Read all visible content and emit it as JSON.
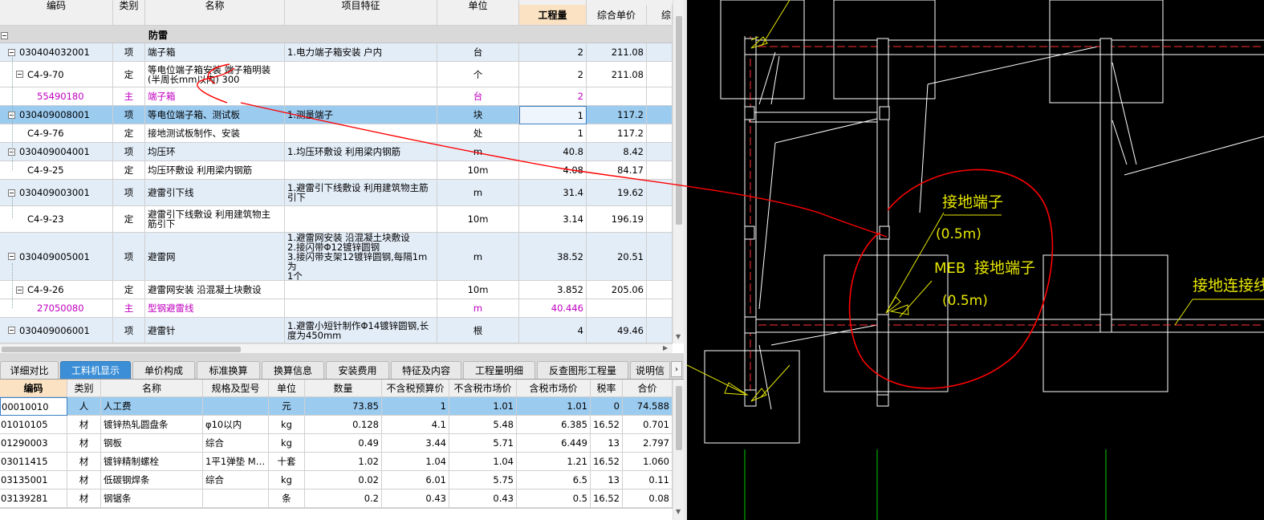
{
  "top_table": {
    "headers": {
      "code": "编码",
      "type": "类别",
      "name": "名称",
      "feature": "项目特征",
      "unit": "单位",
      "qty": "工程量",
      "price": "综合单价",
      "total": "综"
    },
    "group_title": "防雷",
    "rows": [
      {
        "code": "030404032001",
        "type": "项",
        "name": "端子箱",
        "feature": "1.电力端子箱安装 户内",
        "unit": "台",
        "qty": "2",
        "price": "211.08"
      },
      {
        "code": "C4-9-70",
        "type": "定",
        "name": "等电位端子箱安装 端子箱明装\n(半周长mm以内) 300",
        "feature": "",
        "unit": "个",
        "qty": "2",
        "price": "211.08"
      },
      {
        "code": "55490180",
        "type": "主",
        "name": "端子箱",
        "feature": "",
        "unit": "台",
        "qty": "2",
        "price": ""
      },
      {
        "code": "030409008001",
        "type": "项",
        "name": "等电位端子箱、测试板",
        "feature": "1.测量端子",
        "unit": "块",
        "qty": "1",
        "price": "117.2"
      },
      {
        "code": "C4-9-76",
        "type": "定",
        "name": "接地测试板制作、安装",
        "feature": "",
        "unit": "处",
        "qty": "1",
        "price": "117.2"
      },
      {
        "code": "030409004001",
        "type": "项",
        "name": "均压环",
        "feature": "1.均压环敷设 利用梁内钢筋",
        "unit": "m",
        "qty": "40.8",
        "price": "8.42"
      },
      {
        "code": "C4-9-25",
        "type": "定",
        "name": "均压环敷设 利用梁内钢筋",
        "feature": "",
        "unit": "10m",
        "qty": "4.08",
        "price": "84.17"
      },
      {
        "code": "030409003001",
        "type": "项",
        "name": "避雷引下线",
        "feature": "1.避雷引下线敷设 利用建筑物主筋\n引下",
        "unit": "m",
        "qty": "31.4",
        "price": "19.62"
      },
      {
        "code": "C4-9-23",
        "type": "定",
        "name": "避雷引下线敷设 利用建筑物主\n筋引下",
        "feature": "",
        "unit": "10m",
        "qty": "3.14",
        "price": "196.19"
      },
      {
        "code": "030409005001",
        "type": "项",
        "name": "避雷网",
        "feature": "1.避雷网安装 沿混凝土块敷设\n2.接闪带Φ12镀锌圆钢\n3.接闪带支架12镀锌圆钢,每隔1m为\n1个",
        "unit": "m",
        "qty": "38.52",
        "price": "20.51"
      },
      {
        "code": "C4-9-26",
        "type": "定",
        "name": "避雷网安装 沿混凝土块敷设",
        "feature": "",
        "unit": "10m",
        "qty": "3.852",
        "price": "205.06"
      },
      {
        "code": "27050080",
        "type": "主",
        "name": "型钢避雷线",
        "feature": "",
        "unit": "m",
        "qty": "40.446",
        "price": ""
      },
      {
        "code": "030409006001",
        "type": "项",
        "name": "避雷针",
        "feature": "1.避雷小短针制作Φ14镀锌圆钢,长\n度为450mm",
        "unit": "根",
        "qty": "4",
        "price": "49.46"
      }
    ]
  },
  "tabs": [
    "详细对比",
    "工料机显示",
    "单价构成",
    "标准换算",
    "换算信息",
    "安装费用",
    "特征及内容",
    "工程量明细",
    "反查图形工程量",
    "说明信"
  ],
  "active_tab": "工料机显示",
  "bottom_table": {
    "headers": {
      "code": "编码",
      "type": "类别",
      "name": "名称",
      "spec": "规格及型号",
      "unit": "单位",
      "qty": "数量",
      "budget": "不含税预算价",
      "market": "不含税市场价",
      "taxmarket": "含税市场价",
      "rate": "税率",
      "total": "合价"
    },
    "rows": [
      {
        "code": "00010010",
        "type": "人",
        "name": "人工费",
        "spec": "",
        "unit": "元",
        "qty": "73.85",
        "budget": "1",
        "market": "1.01",
        "taxmarket": "1.01",
        "rate": "0",
        "total": "74.588"
      },
      {
        "code": "01010105",
        "type": "材",
        "name": "镀锌热轧圆盘条",
        "spec": "φ10以内",
        "unit": "kg",
        "qty": "0.128",
        "budget": "4.1",
        "market": "5.48",
        "taxmarket": "6.385",
        "rate": "16.52",
        "total": "0.701"
      },
      {
        "code": "01290003",
        "type": "材",
        "name": "钢板",
        "spec": "综合",
        "unit": "kg",
        "qty": "0.49",
        "budget": "3.44",
        "market": "5.71",
        "taxmarket": "6.449",
        "rate": "13",
        "total": "2.797"
      },
      {
        "code": "03011415",
        "type": "材",
        "name": "镀锌精制螺栓",
        "spec": "1平1弹垫 M…",
        "unit": "十套",
        "qty": "1.02",
        "budget": "1.04",
        "market": "1.04",
        "taxmarket": "1.21",
        "rate": "16.52",
        "total": "1.060"
      },
      {
        "code": "03135001",
        "type": "材",
        "name": "低碳钢焊条",
        "spec": "综合",
        "unit": "kg",
        "qty": "0.02",
        "budget": "6.01",
        "market": "5.75",
        "taxmarket": "6.5",
        "rate": "13",
        "total": "0.11"
      },
      {
        "code": "03139281",
        "type": "材",
        "name": "钢锯条",
        "spec": "",
        "unit": "条",
        "qty": "0.2",
        "budget": "0.43",
        "market": "0.43",
        "taxmarket": "0.5",
        "rate": "16.52",
        "total": "0.08"
      }
    ]
  },
  "cad": {
    "label_terminal_1": "接地端子",
    "label_terminal_1_height": "(0.5m)",
    "label_meb": "MEB",
    "label_terminal_2": "接地端子",
    "label_terminal_2_height": "(0.5m)",
    "label_connection": "接地连接线"
  },
  "colors": {
    "cad_bg": "#000000",
    "selected_row": "#9ccbf0",
    "item_row": "#dfeaf7",
    "annotation": "#ff0000",
    "cad_text": "#e6e600",
    "active_tab": "#3c8fd6"
  }
}
